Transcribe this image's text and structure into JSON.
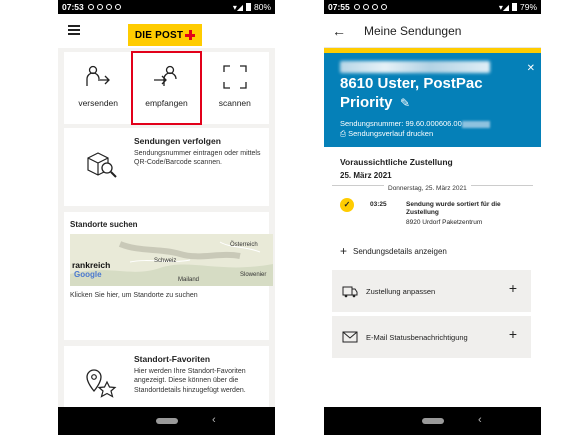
{
  "left": {
    "status": {
      "time": "07:53",
      "battery": "80%"
    },
    "logo_text": "DIE POST",
    "tiles": [
      {
        "label": "versenden",
        "icon": "send-person-icon"
      },
      {
        "label": "empfangen",
        "icon": "receive-person-icon",
        "highlighted": true
      },
      {
        "label": "scannen",
        "icon": "scan-frame-icon"
      }
    ],
    "track": {
      "title": "Sendungen verfolgen",
      "description": "Sendungsnummer eintragen oder mittels QR-Code/Barcode scannen."
    },
    "locations": {
      "title": "Standorte suchen",
      "map_labels": {
        "country_left": "rankreich",
        "schweiz": "Schweiz",
        "oesterreich": "Österreich",
        "mailand": "Mailand",
        "slowenien": "Slowenier",
        "google": "Google"
      },
      "hint": "Klicken Sie hier, um Standorte zu suchen"
    },
    "favorites": {
      "title": "Standort-Favoriten",
      "description": "Hier werden Ihre Standort-Favoriten angezeigt. Diese können über die Standortdetails hinzugefügt werden."
    }
  },
  "right": {
    "status": {
      "time": "07:55",
      "battery": "79%"
    },
    "title": "Meine Sendungen",
    "shipment": {
      "line1": "8610 Uster, PostPac",
      "line2": "Priority",
      "number_label": "Sendungsnummer: 99.60.000606.00",
      "history_link": "Sendungsverlauf drucken"
    },
    "delivery": {
      "label": "Voraussichtliche Zustellung",
      "date": "25. März 2021"
    },
    "event": {
      "date": "Donnerstag, 25. März 2021",
      "time": "03:25",
      "text": "Sendung wurde sortiert für die Zustellung",
      "location": "8920 Urdorf Paketzentrum"
    },
    "details_link": "Sendungsdetails anzeigen",
    "accordions": [
      {
        "label": "Zustellung anpassen",
        "icon": "delivery-adjust-icon"
      },
      {
        "label": "E-Mail Statusbenachrichtigung",
        "icon": "envelope-icon"
      }
    ]
  }
}
